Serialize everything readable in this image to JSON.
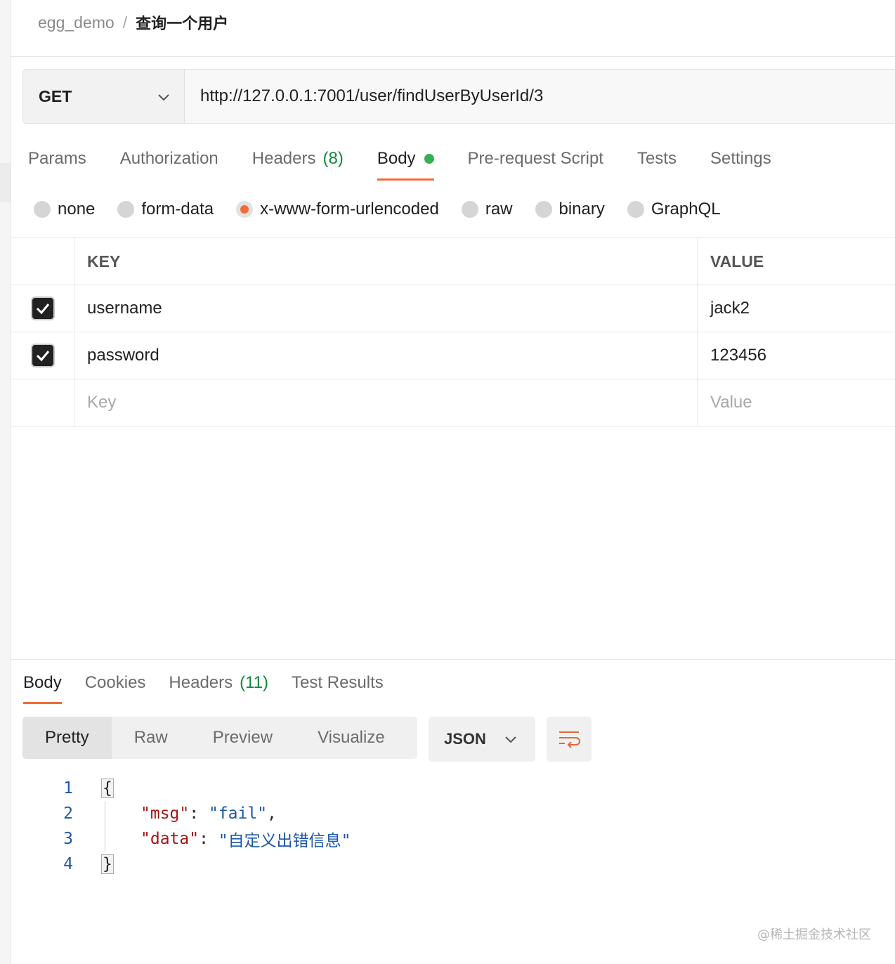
{
  "breadcrumb": {
    "collection": "egg_demo",
    "separator": "/",
    "request": "查询一个用户"
  },
  "request": {
    "method": "GET",
    "url": "http://127.0.0.1:7001/user/findUserByUserId/3"
  },
  "request_tabs": {
    "params": "Params",
    "authorization": "Authorization",
    "headers": "Headers",
    "headers_count": "(8)",
    "body": "Body",
    "pre_request": "Pre-request Script",
    "tests": "Tests",
    "settings": "Settings"
  },
  "body_types": {
    "none": "none",
    "form_data": "form-data",
    "urlencoded": "x-www-form-urlencoded",
    "raw": "raw",
    "binary": "binary",
    "graphql": "GraphQL",
    "selected": "x-www-form-urlencoded"
  },
  "params_table": {
    "key_header": "KEY",
    "value_header": "VALUE",
    "rows": [
      {
        "key": "username",
        "value": "jack2",
        "checked": true
      },
      {
        "key": "password",
        "value": "123456",
        "checked": true
      }
    ],
    "key_placeholder": "Key",
    "value_placeholder": "Value"
  },
  "response_tabs": {
    "body": "Body",
    "cookies": "Cookies",
    "headers": "Headers",
    "headers_count": "(11)",
    "test_results": "Test Results"
  },
  "response_view": {
    "pretty": "Pretty",
    "raw": "Raw",
    "preview": "Preview",
    "visualize": "Visualize",
    "format": "JSON"
  },
  "response_code": {
    "lines": [
      "1",
      "2",
      "3",
      "4"
    ],
    "open_brace": "{",
    "close_brace": "}",
    "msg_key": "\"msg\"",
    "msg_value": "\"fail\"",
    "data_key": "\"data\"",
    "data_value": "\"自定义出错信息\""
  },
  "watermark": "@稀土掘金技术社区",
  "colors": {
    "accent": "#f26b3a",
    "green_dot": "#32b052",
    "count_green": "#0c8a3b",
    "json_key": "#a31515",
    "json_string": "#1a57a8"
  }
}
